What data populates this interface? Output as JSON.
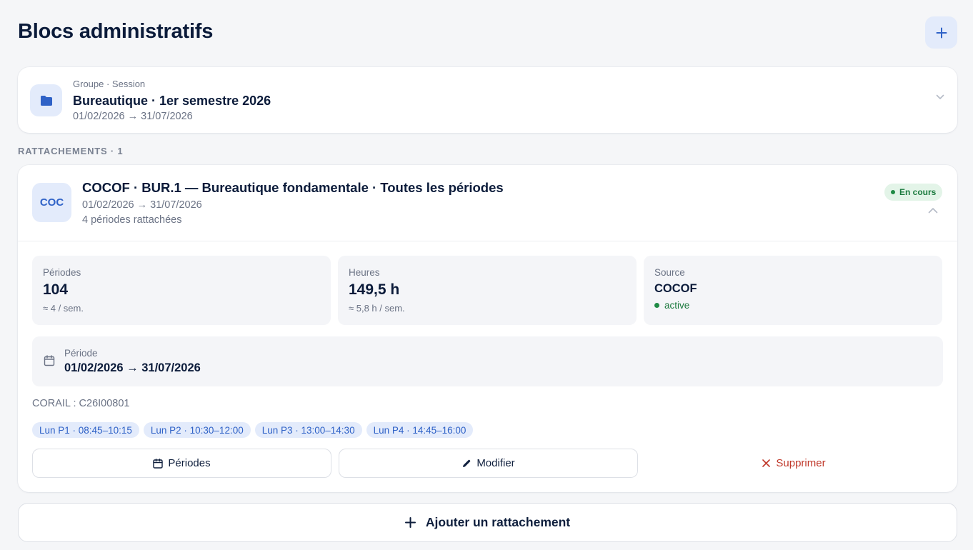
{
  "page": {
    "title": "Blocs administratifs"
  },
  "session": {
    "caption": "Groupe · Session",
    "name": "Bureautique · 1er semestre 2026",
    "dates": "01/02/2026 → 31/07/2026"
  },
  "attachments_label": "RATTACHEMENTS · 1",
  "attachment": {
    "badge": "COC",
    "title": "COCOF · BUR.1 — Bureautique fondamentale · Toutes les périodes",
    "dates": "01/02/2026 → 31/07/2026",
    "count": "4 périodes rattachées",
    "status": "En cours",
    "stats": {
      "periodes": {
        "label": "Périodes",
        "value": "104",
        "sub": "≈ 4 / sem."
      },
      "heures": {
        "label": "Heures",
        "value": "149,5 h",
        "sub": "≈ 5,8 h / sem."
      },
      "source": {
        "label": "Source",
        "value": "COCOF",
        "sub": "active"
      }
    },
    "period": {
      "label": "Période",
      "value": "01/02/2026 → 31/07/2026"
    },
    "corail": "CORAIL : C26I00801",
    "slots": [
      "Lun P1 · 08:45–10:15",
      "Lun P2 · 10:30–12:00",
      "Lun P3 · 13:00–14:30",
      "Lun P4 · 14:45–16:00"
    ],
    "actions": {
      "periodes": "Périodes",
      "modifier": "Modifier",
      "supprimer": "Supprimer"
    }
  },
  "add_attachment": "Ajouter un rattachement",
  "colors": {
    "accent": "#2f62c7",
    "accent_bg": "#e3ebfb",
    "success": "#1f8a45",
    "danger": "#c0392b"
  },
  "icons": [
    "plus-icon",
    "folder-icon",
    "chevron-down-icon",
    "chevron-up-icon",
    "calendar-icon",
    "pencil-icon",
    "close-icon"
  ]
}
